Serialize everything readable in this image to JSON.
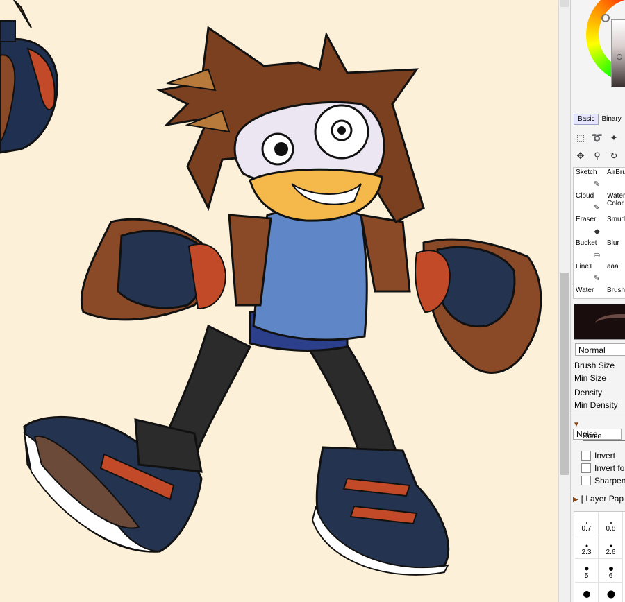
{
  "canvas": {
    "background": "#fdf0d8"
  },
  "panel": {
    "tabs": [
      {
        "label": "Basic",
        "active": true
      },
      {
        "label": "Binary",
        "active": false
      }
    ],
    "tools_row1": [
      "select-rect-icon",
      "lasso-icon",
      "magic-wand-icon"
    ],
    "tools_row2": [
      "move-icon",
      "zoom-icon",
      "rotate-icon"
    ],
    "brushes": [
      {
        "label": "Sketch",
        "label2": ""
      },
      {
        "label": "AirBru",
        "label2": ""
      },
      {
        "label": "Cloud",
        "label2": ""
      },
      {
        "label": "Water",
        "label2": "Color"
      },
      {
        "label": "Eraser",
        "label2": ""
      },
      {
        "label": "Smud",
        "label2": ""
      },
      {
        "label": "Bucket",
        "label2": ""
      },
      {
        "label": "Blur",
        "label2": ""
      },
      {
        "label": "Line1",
        "label2": ""
      },
      {
        "label": "aaa",
        "label2": ""
      },
      {
        "label": "Water",
        "label2": ""
      },
      {
        "label": "Brush",
        "label2": ""
      }
    ],
    "blend_mode": "Normal",
    "brush_size_label": "Brush Size",
    "min_size_label": "Min Size",
    "density_label": "Density",
    "min_density_label": "Min Density",
    "noise_label": "Noise",
    "scale_label": "Scale",
    "invert_label": "Invert",
    "invert_fo_label": "Invert fo",
    "sharpen_label": "Sharpen",
    "layer_paper_label": "[ Layer Pap",
    "dot_sizes": [
      "0.7",
      "0.8",
      "2.3",
      "2.6",
      "5",
      "6"
    ]
  }
}
